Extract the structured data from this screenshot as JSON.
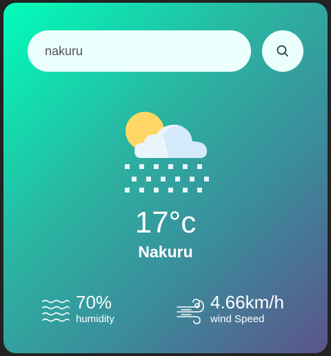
{
  "search": {
    "value": "nakuru",
    "icon": "search-icon"
  },
  "weather": {
    "icon": "snow-cloud-sun-icon",
    "temperature": "17°c",
    "city": "Nakuru"
  },
  "details": {
    "humidity": {
      "icon": "humidity-waves-icon",
      "value": "70%",
      "label": "humidity"
    },
    "wind": {
      "icon": "wind-icon",
      "value": "4.66km/h",
      "label": "wind Speed"
    }
  },
  "colors": {
    "gradient_start": "#00feba",
    "gradient_end": "#5b548a",
    "input_background": "#ebfffc",
    "text": "#ffffff"
  }
}
